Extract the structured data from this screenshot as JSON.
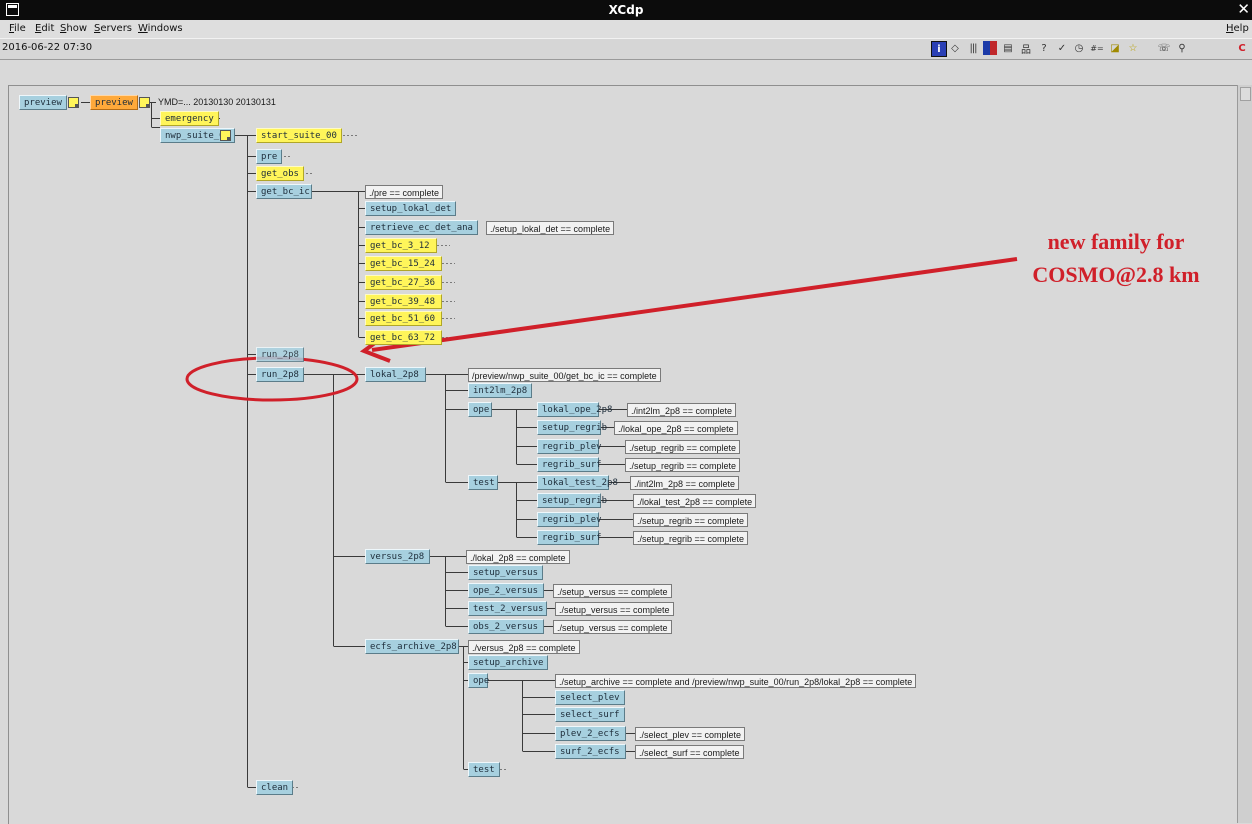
{
  "window": {
    "title": "XCdp"
  },
  "menu": {
    "file": "File",
    "edit": "Edit",
    "show": "Show",
    "servers": "Servers",
    "windows": "Windows",
    "help": "Help"
  },
  "status": {
    "datetime": "2016-06-22 07:30"
  },
  "toolbar_icons": [
    "info-icon",
    "diamond-icon",
    "bars-icon",
    "color-square-icon",
    "window-icon",
    "tree-icon",
    "question-icon",
    "check-icon",
    "clock-icon",
    "counter-icon",
    "note-icon",
    "star-icon",
    "phone-icon",
    "search-icon",
    "close-icon"
  ],
  "tree": {
    "server": "preview",
    "suite": "preview",
    "suite_vars": "YMD=... 20130130 20130131",
    "emergency": "emergency",
    "nwp_suite_00": "nwp_suite_00",
    "start_suite_00": "start_suite_00",
    "pre": "pre",
    "get_obs": "get_obs",
    "get_bc_ic": {
      "name": "get_bc_ic",
      "trigger": "./pre == complete",
      "setup_lokal_det": "setup_lokal_det",
      "retrieve": "retrieve_ec_det_ana",
      "retrieve_trigger": "./setup_lokal_det == complete",
      "get_bc": [
        "get_bc_3_12",
        "get_bc_15_24",
        "get_bc_27_36",
        "get_bc_39_48",
        "get_bc_51_60",
        "get_bc_63_72"
      ]
    },
    "run_hidden": "run_2p8",
    "run_2p8": "run_2p8",
    "lokal_2p8": {
      "name": "lokal_2p8",
      "trigger": "/preview/nwp_suite_00/get_bc_ic == complete",
      "int2lm": "int2lm_2p8",
      "ope": {
        "name": "ope",
        "lokal": "lokal_ope_2p8",
        "lokal_trigger": "./int2lm_2p8 == complete",
        "setup_regrib": "setup_regrib",
        "setup_regrib_trigger": "./lokal_ope_2p8 == complete",
        "regrib_plev": "regrib_plev",
        "regrib_plev_trigger": "./setup_regrib == complete",
        "regrib_surf": "regrib_surf",
        "regrib_surf_trigger": "./setup_regrib == complete"
      },
      "test": {
        "name": "test",
        "lokal": "lokal_test_2p8",
        "lokal_trigger": "./int2lm_2p8 == complete",
        "setup_regrib": "setup_regrib",
        "setup_regrib_trigger": "./lokal_test_2p8 == complete",
        "regrib_plev": "regrib_plev",
        "regrib_plev_trigger": "./setup_regrib == complete",
        "regrib_surf": "regrib_surf",
        "regrib_surf_trigger": "./setup_regrib == complete"
      }
    },
    "versus_2p8": {
      "name": "versus_2p8",
      "trigger": "./lokal_2p8 == complete",
      "setup_versus": "setup_versus",
      "ope_2_versus": "ope_2_versus",
      "ope_2_versus_trigger": "./setup_versus == complete",
      "test_2_versus": "test_2_versus",
      "test_2_versus_trigger": "./setup_versus == complete",
      "obs_2_versus": "obs_2_versus",
      "obs_2_versus_trigger": "./setup_versus == complete"
    },
    "ecfs_archive_2p8": {
      "name": "ecfs_archive_2p8",
      "trigger": "./versus_2p8 == complete",
      "setup_archive": "setup_archive",
      "ope": "ope",
      "ope_trigger": "./setup_archive == complete and /preview/nwp_suite_00/run_2p8/lokal_2p8 == complete",
      "select_plev": "select_plev",
      "select_surf": "select_surf",
      "plev_2_ecfs": "plev_2_ecfs",
      "plev_2_ecfs_trigger": "./select_plev == complete",
      "surf_2_ecfs": "surf_2_ecfs",
      "surf_2_ecfs_trigger": "./select_surf == complete",
      "test": "test"
    },
    "clean": "clean"
  },
  "annotation": {
    "line1": "new family for",
    "line2": "COSMO@2.8 km",
    "color": "#d0202a"
  },
  "colors": {
    "queued": "#a7d0df",
    "active": "#fff55a",
    "suspended": "#ffa93a"
  }
}
